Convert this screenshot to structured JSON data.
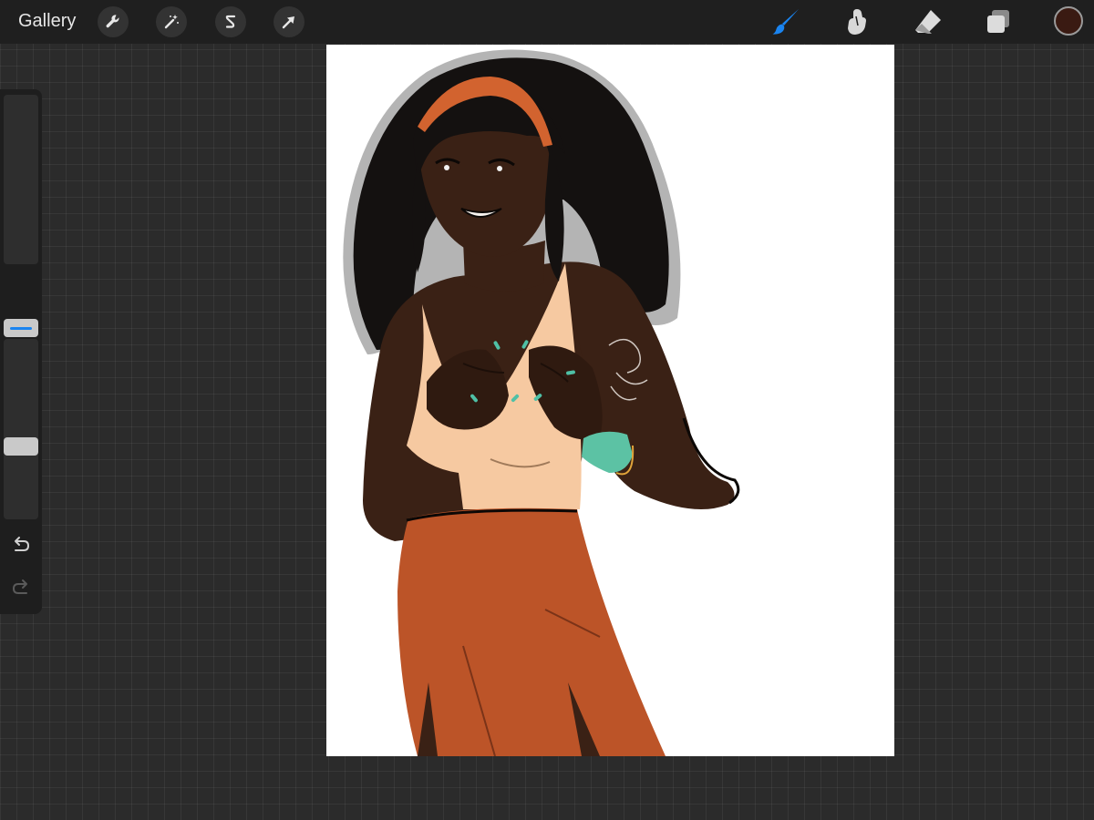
{
  "toolbar": {
    "gallery_label": "Gallery",
    "left_tools": [
      "wrench-icon",
      "magic-wand-icon",
      "selection-s-icon",
      "transform-arrow-icon"
    ],
    "right_tools": [
      "brush-icon",
      "smudge-icon",
      "eraser-icon",
      "layers-icon"
    ],
    "active_tool": "brush",
    "accent_color": "#1a84f0",
    "current_color": "#3a1a12"
  },
  "sidebar": {
    "brush_size": 0.22,
    "brush_opacity": 1.0,
    "icons": [
      "modify-square-icon",
      "undo-icon",
      "redo-icon"
    ]
  },
  "canvas": {
    "background": "#ffffff",
    "palette": {
      "hair": "#141110",
      "skin": "#3b2216",
      "headband": "#d2632f",
      "top": "#f6c9a1",
      "skirt": "#bc5428",
      "bracelet": "#5cc2a4",
      "nails": "#4fc0a6"
    }
  }
}
